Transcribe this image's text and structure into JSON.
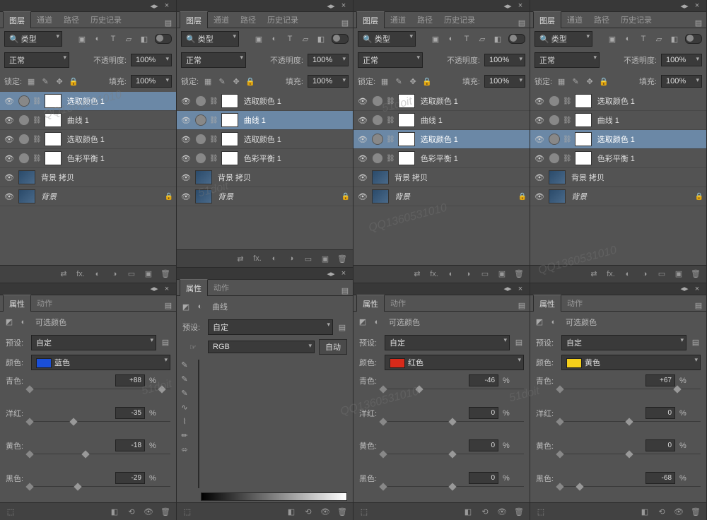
{
  "common": {
    "tabs": [
      "图层",
      "通道",
      "路径",
      "历史记录"
    ],
    "propsTabs": [
      "属性",
      "动作"
    ],
    "filterLabel": "类型",
    "blendMode": "正常",
    "opacityLabel": "不透明度:",
    "opacity": "100%",
    "lockLabel": "锁定:",
    "fillLabel": "填充:",
    "fill": "100%",
    "presetLabel": "预设:",
    "presetValue": "自定",
    "colorLabel": "颜色:",
    "cyanLabel": "青色:",
    "magentaLabel": "洋红:",
    "yellowLabel": "黄色:",
    "blackLabel": "黑色:",
    "layers": [
      {
        "name": "选取颜色 1",
        "type": "adj"
      },
      {
        "name": "曲线 1",
        "type": "adj"
      },
      {
        "name": "选取颜色 1",
        "type": "adj"
      },
      {
        "name": "色彩平衡 1",
        "type": "adj"
      },
      {
        "name": "背景 拷贝",
        "type": "img"
      },
      {
        "name": "背景",
        "type": "img",
        "locked": true,
        "italic": true
      }
    ]
  },
  "cols": [
    {
      "selectedLayer": 0,
      "propsTitle": "可选颜色",
      "colorName": "蓝色",
      "colorHex": "#1a4fd8",
      "sliders": {
        "cyan": "+88",
        "magenta": "-35",
        "yellow": "-18",
        "black": "-29"
      }
    },
    {
      "selectedLayer": 1,
      "propsTitle": "曲线",
      "curvesChannel": "RGB",
      "autoBtn": "自动"
    },
    {
      "selectedLayer": 2,
      "propsTitle": "可选颜色",
      "colorName": "红色",
      "colorHex": "#d82a1a",
      "sliders": {
        "cyan": "-46",
        "magenta": "0",
        "yellow": "0",
        "black": "0"
      }
    },
    {
      "selectedLayer": 2,
      "propsTitle": "可选颜色",
      "colorName": "黄色",
      "colorHex": "#f5cf1a",
      "sliders": {
        "cyan": "+67",
        "magenta": "0",
        "yellow": "0",
        "black": "-68"
      }
    }
  ],
  "watermarks": [
    "QQ1360531010",
    "51doit"
  ]
}
